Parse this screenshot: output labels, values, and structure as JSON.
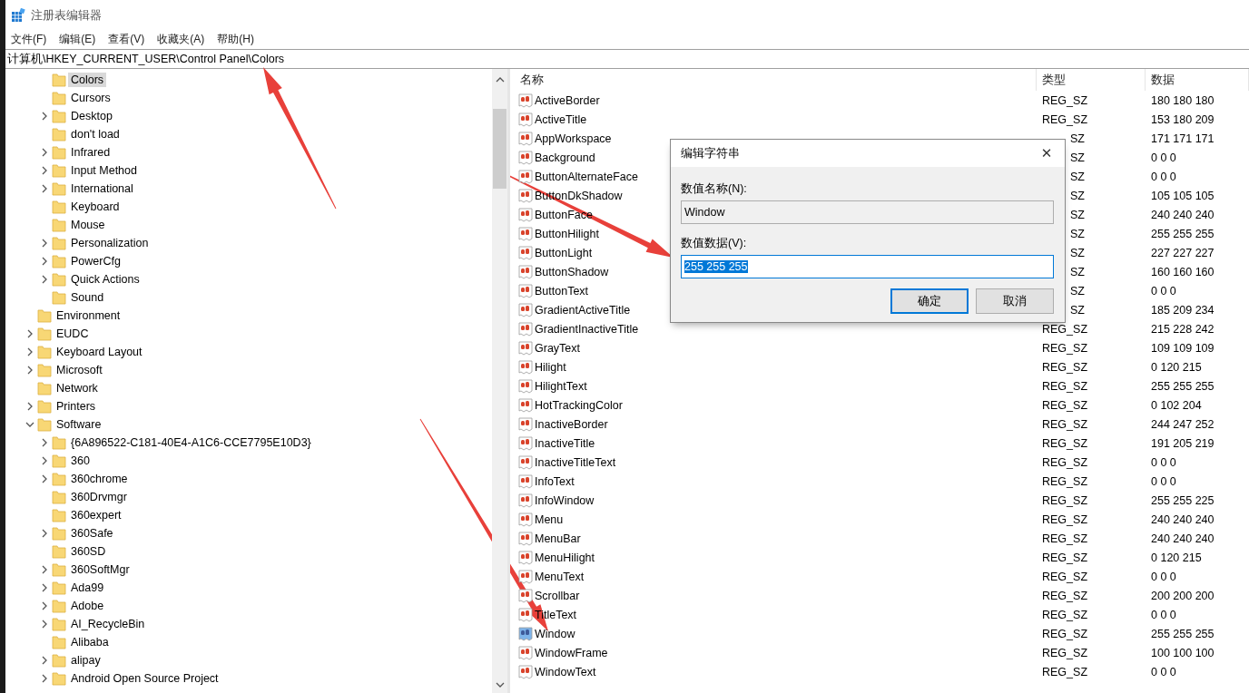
{
  "window": {
    "title": "注册表编辑器"
  },
  "menu": [
    "文件(F)",
    "编辑(E)",
    "查看(V)",
    "收藏夹(A)",
    "帮助(H)"
  ],
  "address": "计算机\\HKEY_CURRENT_USER\\Control Panel\\Colors",
  "tree": [
    {
      "children": [
        {
          "label": "Colors",
          "expandable": false,
          "selected": true
        },
        {
          "label": "Cursors",
          "expandable": false,
          "selected": false
        },
        {
          "label": "Desktop",
          "expandable": true,
          "selected": false
        },
        {
          "label": "don't load",
          "expandable": false,
          "selected": false
        },
        {
          "label": "Infrared",
          "expandable": true,
          "selected": false
        },
        {
          "label": "Input Method",
          "expandable": true,
          "selected": false
        },
        {
          "label": "International",
          "expandable": true,
          "selected": false
        },
        {
          "label": "Keyboard",
          "expandable": false,
          "selected": false
        },
        {
          "label": "Mouse",
          "expandable": false,
          "selected": false
        },
        {
          "label": "Personalization",
          "expandable": true,
          "selected": false
        },
        {
          "label": "PowerCfg",
          "expandable": true,
          "selected": false
        },
        {
          "label": "Quick Actions",
          "expandable": true,
          "selected": false
        },
        {
          "label": "Sound",
          "expandable": false,
          "selected": false
        }
      ]
    },
    {
      "label": "Environment",
      "expandable": false,
      "selected": false
    },
    {
      "label": "EUDC",
      "expandable": true,
      "selected": false
    },
    {
      "label": "Keyboard Layout",
      "expandable": true,
      "selected": false
    },
    {
      "label": "Microsoft",
      "expandable": true,
      "selected": false
    },
    {
      "label": "Network",
      "expandable": false,
      "selected": false
    },
    {
      "label": "Printers",
      "expandable": true,
      "selected": false
    },
    {
      "label": "Software",
      "expandable": true,
      "expanded": true,
      "selected": false,
      "children": [
        {
          "label": "{6A896522-C181-40E4-A1C6-CCE7795E10D3}",
          "expandable": true,
          "selected": false
        },
        {
          "label": "360",
          "expandable": true,
          "selected": false
        },
        {
          "label": "360chrome",
          "expandable": true,
          "selected": false
        },
        {
          "label": "360Drvmgr",
          "expandable": false,
          "selected": false
        },
        {
          "label": "360expert",
          "expandable": false,
          "selected": false
        },
        {
          "label": "360Safe",
          "expandable": true,
          "selected": false
        },
        {
          "label": "360SD",
          "expandable": false,
          "selected": false
        },
        {
          "label": "360SoftMgr",
          "expandable": true,
          "selected": false
        },
        {
          "label": "Ada99",
          "expandable": true,
          "selected": false
        },
        {
          "label": "Adobe",
          "expandable": true,
          "selected": false
        },
        {
          "label": "AI_RecycleBin",
          "expandable": true,
          "selected": false
        },
        {
          "label": "Alibaba",
          "expandable": false,
          "selected": false
        },
        {
          "label": "alipay",
          "expandable": true,
          "selected": false
        },
        {
          "label": "Android Open Source Project",
          "expandable": true,
          "selected": false
        }
      ]
    }
  ],
  "table": {
    "columns": [
      "名称",
      "类型",
      "数据"
    ],
    "rows": [
      {
        "name": "ActiveBorder",
        "type": "REG_SZ",
        "data": "180 180 180",
        "selected": false
      },
      {
        "name": "ActiveTitle",
        "type": "REG_SZ",
        "data": "153 180 209",
        "selected": false
      },
      {
        "name": "AppWorkspace",
        "type": "SZ",
        "type_covered": true,
        "data": "171 171 171",
        "selected": false
      },
      {
        "name": "Background",
        "type": "SZ",
        "type_covered": true,
        "data": "0 0 0",
        "selected": false
      },
      {
        "name": "ButtonAlternateFace",
        "type": "SZ",
        "type_covered": true,
        "data": "0 0 0",
        "selected": false
      },
      {
        "name": "ButtonDkShadow",
        "type": "SZ",
        "type_covered": true,
        "data": "105 105 105",
        "selected": false
      },
      {
        "name": "ButtonFace",
        "type": "SZ",
        "type_covered": true,
        "data": "240 240 240",
        "selected": false
      },
      {
        "name": "ButtonHilight",
        "type": "SZ",
        "type_covered": true,
        "data": "255 255 255",
        "selected": false
      },
      {
        "name": "ButtonLight",
        "type": "SZ",
        "type_covered": true,
        "data": "227 227 227",
        "selected": false
      },
      {
        "name": "ButtonShadow",
        "type": "SZ",
        "type_covered": true,
        "data": "160 160 160",
        "selected": false
      },
      {
        "name": "ButtonText",
        "type": "SZ",
        "type_covered": true,
        "data": "0 0 0",
        "selected": false
      },
      {
        "name": "GradientActiveTitle",
        "type": "SZ",
        "type_covered": true,
        "data": "185 209 234",
        "selected": false
      },
      {
        "name": "GradientInactiveTitle",
        "type": "REG_SZ",
        "data": "215 228 242",
        "selected": false
      },
      {
        "name": "GrayText",
        "type": "REG_SZ",
        "data": "109 109 109",
        "selected": false
      },
      {
        "name": "Hilight",
        "type": "REG_SZ",
        "data": "0 120 215",
        "selected": false
      },
      {
        "name": "HilightText",
        "type": "REG_SZ",
        "data": "255 255 255",
        "selected": false
      },
      {
        "name": "HotTrackingColor",
        "type": "REG_SZ",
        "data": "0 102 204",
        "selected": false
      },
      {
        "name": "InactiveBorder",
        "type": "REG_SZ",
        "data": "244 247 252",
        "selected": false
      },
      {
        "name": "InactiveTitle",
        "type": "REG_SZ",
        "data": "191 205 219",
        "selected": false
      },
      {
        "name": "InactiveTitleText",
        "type": "REG_SZ",
        "data": "0 0 0",
        "selected": false
      },
      {
        "name": "InfoText",
        "type": "REG_SZ",
        "data": "0 0 0",
        "selected": false
      },
      {
        "name": "InfoWindow",
        "type": "REG_SZ",
        "data": "255 255 225",
        "selected": false
      },
      {
        "name": "Menu",
        "type": "REG_SZ",
        "data": "240 240 240",
        "selected": false
      },
      {
        "name": "MenuBar",
        "type": "REG_SZ",
        "data": "240 240 240",
        "selected": false
      },
      {
        "name": "MenuHilight",
        "type": "REG_SZ",
        "data": "0 120 215",
        "selected": false
      },
      {
        "name": "MenuText",
        "type": "REG_SZ",
        "data": "0 0 0",
        "selected": false
      },
      {
        "name": "Scrollbar",
        "type": "REG_SZ",
        "data": "200 200 200",
        "selected": false
      },
      {
        "name": "TitleText",
        "type": "REG_SZ",
        "data": "0 0 0",
        "selected": false
      },
      {
        "name": "Window",
        "type": "REG_SZ",
        "data": "255 255 255",
        "selected": true
      },
      {
        "name": "WindowFrame",
        "type": "REG_SZ",
        "data": "100 100 100",
        "selected": false
      },
      {
        "name": "WindowText",
        "type": "REG_SZ",
        "data": "0 0 0",
        "selected": false
      }
    ]
  },
  "dialog": {
    "title": "编辑字符串",
    "close": "✕",
    "name_label": "数值名称(N):",
    "name_value": "Window",
    "data_label": "数值数据(V):",
    "data_value": "255 255 255",
    "data_selected": true,
    "buttons": [
      {
        "label": "确定",
        "default": true
      },
      {
        "label": "取消",
        "default": false
      }
    ]
  }
}
